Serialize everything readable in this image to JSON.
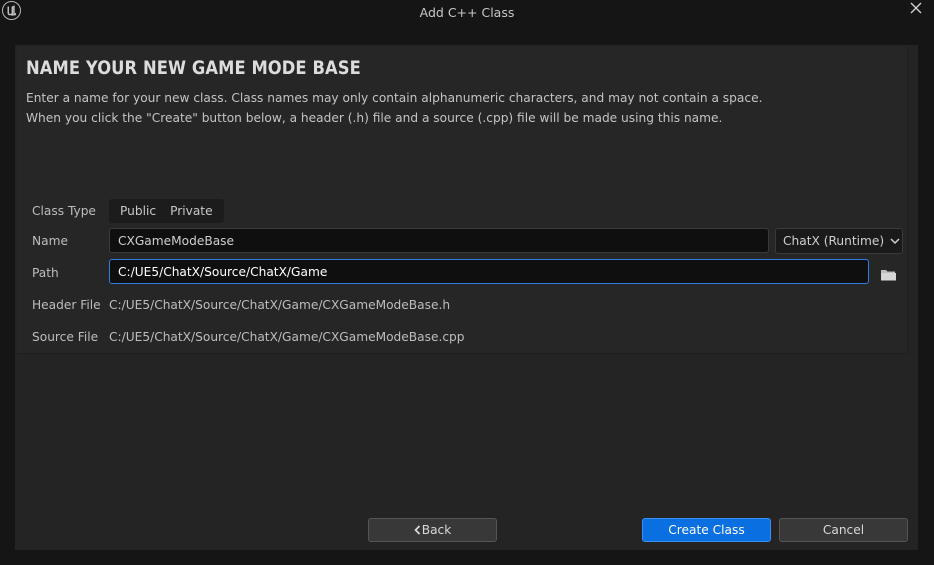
{
  "window": {
    "title": "Add C++ Class"
  },
  "heading": "NAME YOUR NEW GAME MODE BASE",
  "description": {
    "line1": "Enter a name for your new class. Class names may only contain alphanumeric characters, and may not contain a space.",
    "line2": "When you click the \"Create\" button below, a header (.h) file and a source (.cpp) file will be made using this name."
  },
  "form": {
    "class_type_label": "Class Type",
    "class_type_options": [
      "Public",
      "Private"
    ],
    "name_label": "Name",
    "name_value": "CXGameModeBase",
    "module_value": "ChatX (Runtime)",
    "path_label": "Path",
    "path_value": "C:/UE5/ChatX/Source/ChatX/Game",
    "header_label": "Header File",
    "header_value": "C:/UE5/ChatX/Source/ChatX/Game/CXGameModeBase.h",
    "source_label": "Source File",
    "source_value": "C:/UE5/ChatX/Source/ChatX/Game/CXGameModeBase.cpp"
  },
  "buttons": {
    "back": "Back",
    "create": "Create Class",
    "cancel": "Cancel"
  },
  "icons": {
    "logo": "unreal-logo-icon",
    "close": "close-icon",
    "folder": "folder-icon",
    "back": "chevron-left-icon",
    "dropdown": "chevron-down-icon"
  },
  "colors": {
    "accent": "#0a6fe0",
    "focus_border": "#2f7de0"
  }
}
